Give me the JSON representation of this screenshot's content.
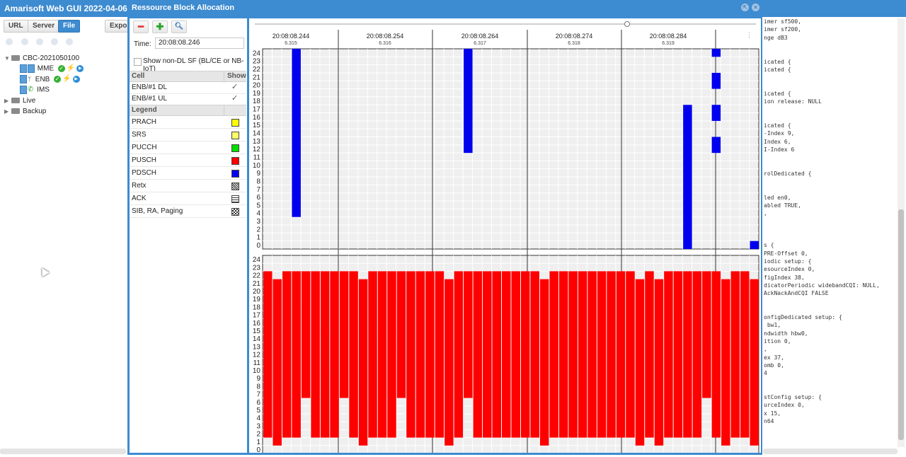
{
  "app": {
    "title": "Amarisoft Web GUI 2022-04-06"
  },
  "toolbar": {
    "url": "URL",
    "server": "Server",
    "file": "File",
    "export": "Export"
  },
  "tree": {
    "root": "CBC-2021050100",
    "mme": "MME",
    "enb": "ENB",
    "ims": "IMS",
    "live": "Live",
    "backup": "Backup"
  },
  "rba": {
    "title": "Ressource Block Allocation",
    "time_label": "Time:",
    "time_value": "20:08:08.246",
    "show_nondl": "Show non-DL SF (BL/CE or NB-IoT)",
    "cell_header": "Cell",
    "show_header": "Show",
    "cells": [
      {
        "name": "ENB/#1 DL",
        "checked": true
      },
      {
        "name": "ENB/#1 UL",
        "checked": true
      }
    ],
    "legend_header": "Legend",
    "legend": [
      {
        "name": "PRACH",
        "color": "#ffff00",
        "style": "solid"
      },
      {
        "name": "SRS",
        "color": "#ffff66",
        "style": "solid"
      },
      {
        "name": "PUCCH",
        "color": "#00dd00",
        "style": "solid"
      },
      {
        "name": "PUSCH",
        "color": "#ff0000",
        "style": "solid"
      },
      {
        "name": "PDSCH",
        "color": "#0000ee",
        "style": "solid"
      },
      {
        "name": "Retx",
        "color": "#333333",
        "style": "hatch"
      },
      {
        "name": "ACK",
        "color": "#333333",
        "style": "grid"
      },
      {
        "name": "SIB, RA, Paging",
        "color": "#333333",
        "style": "check"
      }
    ]
  },
  "timeline": {
    "times": [
      "20:08:08.244",
      "20:08:08.254",
      "20:08:08.264",
      "20:08:08.274",
      "20:08:08.284"
    ],
    "sfs": [
      "6.315",
      "6.316",
      "6.317",
      "6.318",
      "6.319"
    ],
    "rb_labels": [
      "24",
      "23",
      "22",
      "21",
      "20",
      "19",
      "18",
      "17",
      "16",
      "15",
      "14",
      "13",
      "12",
      "11",
      "10",
      "9",
      "8",
      "7",
      "6",
      "5",
      "4",
      "3",
      "2",
      "1",
      "0"
    ],
    "slots": 52,
    "dl_bars": [
      {
        "slot": 3,
        "lo": 4,
        "hi": 24
      },
      {
        "slot": 21,
        "lo": 12,
        "hi": 24
      },
      {
        "slot": 44,
        "lo": 0,
        "hi": 17
      },
      {
        "slot": 47,
        "lo": 24,
        "hi": 24
      },
      {
        "slot": 47,
        "lo": 20,
        "hi": 21
      },
      {
        "slot": 47,
        "lo": 16,
        "hi": 17
      },
      {
        "slot": 47,
        "lo": 12,
        "hi": 13
      },
      {
        "slot": 51,
        "lo": 0,
        "hi": 0
      }
    ],
    "ul_bars": [
      [
        2,
        22
      ],
      [
        1,
        21
      ],
      [
        2,
        22
      ],
      [
        2,
        22
      ],
      [
        7,
        22
      ],
      [
        2,
        22
      ],
      [
        2,
        22
      ],
      [
        2,
        22
      ],
      [
        7,
        22
      ],
      [
        2,
        22
      ],
      [
        1,
        21
      ],
      [
        2,
        22
      ],
      [
        2,
        22
      ],
      [
        2,
        22
      ],
      [
        7,
        22
      ],
      [
        2,
        22
      ],
      [
        2,
        22
      ],
      [
        2,
        22
      ],
      [
        2,
        22
      ],
      [
        1,
        21
      ],
      [
        2,
        22
      ],
      [
        7,
        22
      ],
      [
        2,
        22
      ],
      [
        2,
        22
      ],
      [
        2,
        22
      ],
      [
        2,
        22
      ],
      [
        2,
        22
      ],
      [
        2,
        22
      ],
      [
        2,
        22
      ],
      [
        1,
        21
      ],
      [
        2,
        22
      ],
      [
        2,
        22
      ],
      [
        2,
        22
      ],
      [
        2,
        22
      ],
      [
        2,
        22
      ],
      [
        2,
        22
      ],
      [
        2,
        22
      ],
      [
        2,
        22
      ],
      [
        2,
        22
      ],
      [
        1,
        21
      ],
      [
        2,
        22
      ],
      [
        1,
        21
      ],
      [
        2,
        22
      ],
      [
        2,
        22
      ],
      [
        2,
        22
      ],
      [
        2,
        22
      ],
      [
        7,
        22
      ],
      [
        2,
        22
      ],
      [
        1,
        21
      ],
      [
        2,
        22
      ],
      [
        2,
        22
      ],
      [
        1,
        21
      ]
    ]
  },
  "code_lines": [
    "imer sf500,",
    "imer sf200,",
    "nge dB3",
    "",
    "",
    "icated {",
    "icated {",
    "",
    "",
    "icated {",
    "ion release: NULL",
    "",
    "",
    "icated {",
    "-Index 9,",
    "Index 6,",
    "I-Index 6",
    "",
    "",
    "rolDedicated {",
    "",
    "",
    "led en0,",
    "abled TRUE,",
    ",",
    "",
    "",
    "",
    "s {",
    "PRE-Offset 0,",
    "iodic setup: {",
    "esourceIndex 0,",
    "figIndex 38,",
    "dicatorPeriodic widebandCQI: NULL,",
    "AckNackAndCQI FALSE",
    "",
    "",
    "onfigDedicated setup: {",
    " bw1,",
    "ndwidth hbw0,",
    "ition 0,",
    ",",
    "ex 37,",
    "omb 0,",
    "4",
    "",
    "",
    "stConfig setup: {",
    "urceIndex 0,",
    "x 15,",
    "n64"
  ]
}
